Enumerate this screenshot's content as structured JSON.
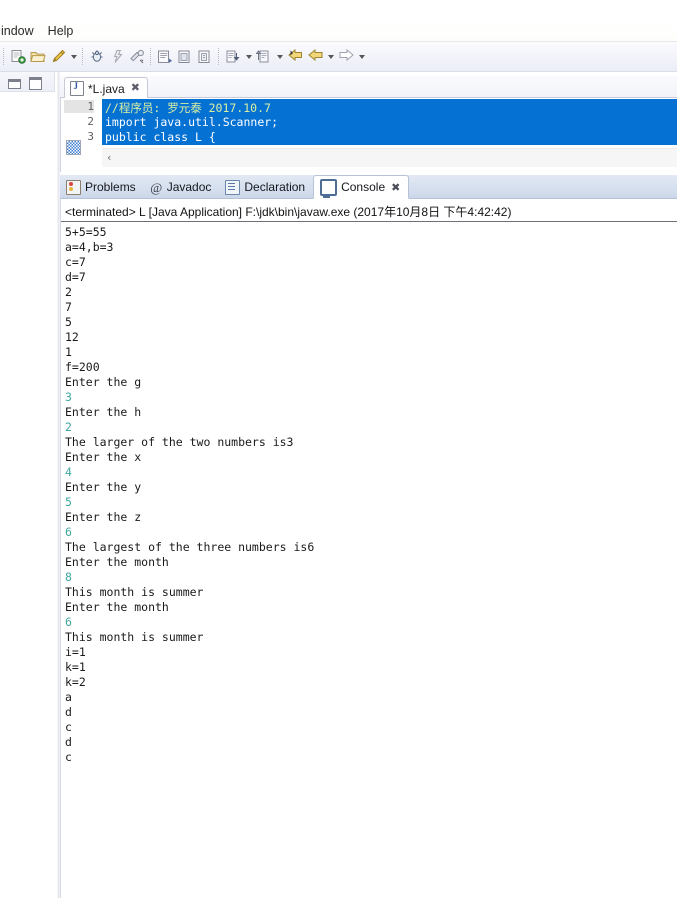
{
  "menubar": {
    "items": [
      {
        "label": "indow"
      },
      {
        "label": "Help"
      }
    ]
  },
  "toolbar": {
    "groups": [
      {
        "buttons": [
          {
            "name": "new-wizard-icon",
            "glyph": "new"
          },
          {
            "name": "open-folder-icon",
            "glyph": "folder"
          },
          {
            "name": "save-pen-icon",
            "glyph": "pen"
          }
        ],
        "dropdown": true
      },
      {
        "buttons": [
          {
            "name": "debug-icon",
            "glyph": "debug"
          },
          {
            "name": "run-icon",
            "glyph": "run"
          },
          {
            "name": "external-tools-icon",
            "glyph": "tools"
          }
        ],
        "dropdown": false
      },
      {
        "buttons": [
          {
            "name": "new-java-project-icon",
            "glyph": "proj"
          },
          {
            "name": "new-java-package-icon",
            "glyph": "pkg"
          },
          {
            "name": "new-java-class-icon",
            "glyph": "cls"
          }
        ],
        "dropdown": false
      },
      {
        "buttons": [
          {
            "name": "next-annotation-icon",
            "glyph": "nextanno"
          }
        ],
        "dropdown": true
      },
      {
        "buttons": [
          {
            "name": "previous-annotation-icon",
            "glyph": "prevanno"
          }
        ],
        "dropdown": true
      },
      {
        "buttons": [
          {
            "name": "last-edit-location-icon",
            "glyph": "lastedit"
          },
          {
            "name": "back-arrow-icon",
            "glyph": "back"
          }
        ],
        "dropdown": true
      },
      {
        "buttons": [
          {
            "name": "forward-arrow-icon",
            "glyph": "forward"
          }
        ],
        "dropdown": true
      }
    ]
  },
  "left_view_bar": {
    "restore_tooltip": "Restore",
    "maximize_tooltip": "Maximize"
  },
  "editor": {
    "tab": {
      "label": "*L.java",
      "close": "✖",
      "file_icon": "java-file-icon",
      "dirty": true
    },
    "line_numbers": [
      "1",
      "2",
      "3"
    ],
    "lines": [
      {
        "num": "1",
        "text": "//程序员: 罗元泰 2017.10.7",
        "kind": "comment"
      },
      {
        "num": "2",
        "text": "import java.util.Scanner;",
        "kind": "code"
      },
      {
        "num": "3",
        "text": "public class L {",
        "kind": "code"
      }
    ],
    "selection_color": "#0571d3",
    "horizontal_scroll_marker": "‹"
  },
  "console_panel": {
    "tabs": [
      {
        "label": "Problems",
        "icon": "problems-icon",
        "active": false,
        "closeable": false
      },
      {
        "label": "Javadoc",
        "icon": "javadoc-icon",
        "active": false,
        "closeable": false
      },
      {
        "label": "Declaration",
        "icon": "declaration-icon",
        "active": false,
        "closeable": false
      },
      {
        "label": "Console",
        "icon": "console-icon",
        "active": true,
        "closeable": true,
        "close": "✖"
      }
    ],
    "status_line": "<terminated> L [Java Application] F:\\jdk\\bin\\javaw.exe (2017年10月8日 下午4:42:42)",
    "output": [
      {
        "text": "5+5=55",
        "kind": "out"
      },
      {
        "text": "a=4,b=3",
        "kind": "out"
      },
      {
        "text": "c=7",
        "kind": "out"
      },
      {
        "text": "d=7",
        "kind": "out"
      },
      {
        "text": "2",
        "kind": "out"
      },
      {
        "text": "7",
        "kind": "out"
      },
      {
        "text": "5",
        "kind": "out"
      },
      {
        "text": "12",
        "kind": "out"
      },
      {
        "text": "1",
        "kind": "out"
      },
      {
        "text": "f=200",
        "kind": "out"
      },
      {
        "text": "Enter the g",
        "kind": "out"
      },
      {
        "text": "3",
        "kind": "input"
      },
      {
        "text": "Enter the h",
        "kind": "out"
      },
      {
        "text": "2",
        "kind": "input"
      },
      {
        "text": "The larger of the two numbers is3",
        "kind": "out"
      },
      {
        "text": "Enter the x",
        "kind": "out"
      },
      {
        "text": "4",
        "kind": "input"
      },
      {
        "text": "Enter the y",
        "kind": "out"
      },
      {
        "text": "5",
        "kind": "input"
      },
      {
        "text": "Enter the z",
        "kind": "out"
      },
      {
        "text": "6",
        "kind": "input"
      },
      {
        "text": "The largest of the three numbers is6",
        "kind": "out"
      },
      {
        "text": "Enter the month",
        "kind": "out"
      },
      {
        "text": "8",
        "kind": "input"
      },
      {
        "text": "This month is summer",
        "kind": "out"
      },
      {
        "text": "Enter the month",
        "kind": "out"
      },
      {
        "text": "6",
        "kind": "input"
      },
      {
        "text": "This month is summer",
        "kind": "out"
      },
      {
        "text": "i=1",
        "kind": "out"
      },
      {
        "text": "k=1",
        "kind": "out"
      },
      {
        "text": "k=2",
        "kind": "out"
      },
      {
        "text": "a",
        "kind": "out"
      },
      {
        "text": "d",
        "kind": "out"
      },
      {
        "text": "c",
        "kind": "out"
      },
      {
        "text": "d",
        "kind": "out"
      },
      {
        "text": "c",
        "kind": "out"
      }
    ],
    "colors": {
      "output_text": "#1a1a1a",
      "input_echo": "#3fa8a0",
      "tabbar_bg": "#ccd8ea"
    }
  }
}
